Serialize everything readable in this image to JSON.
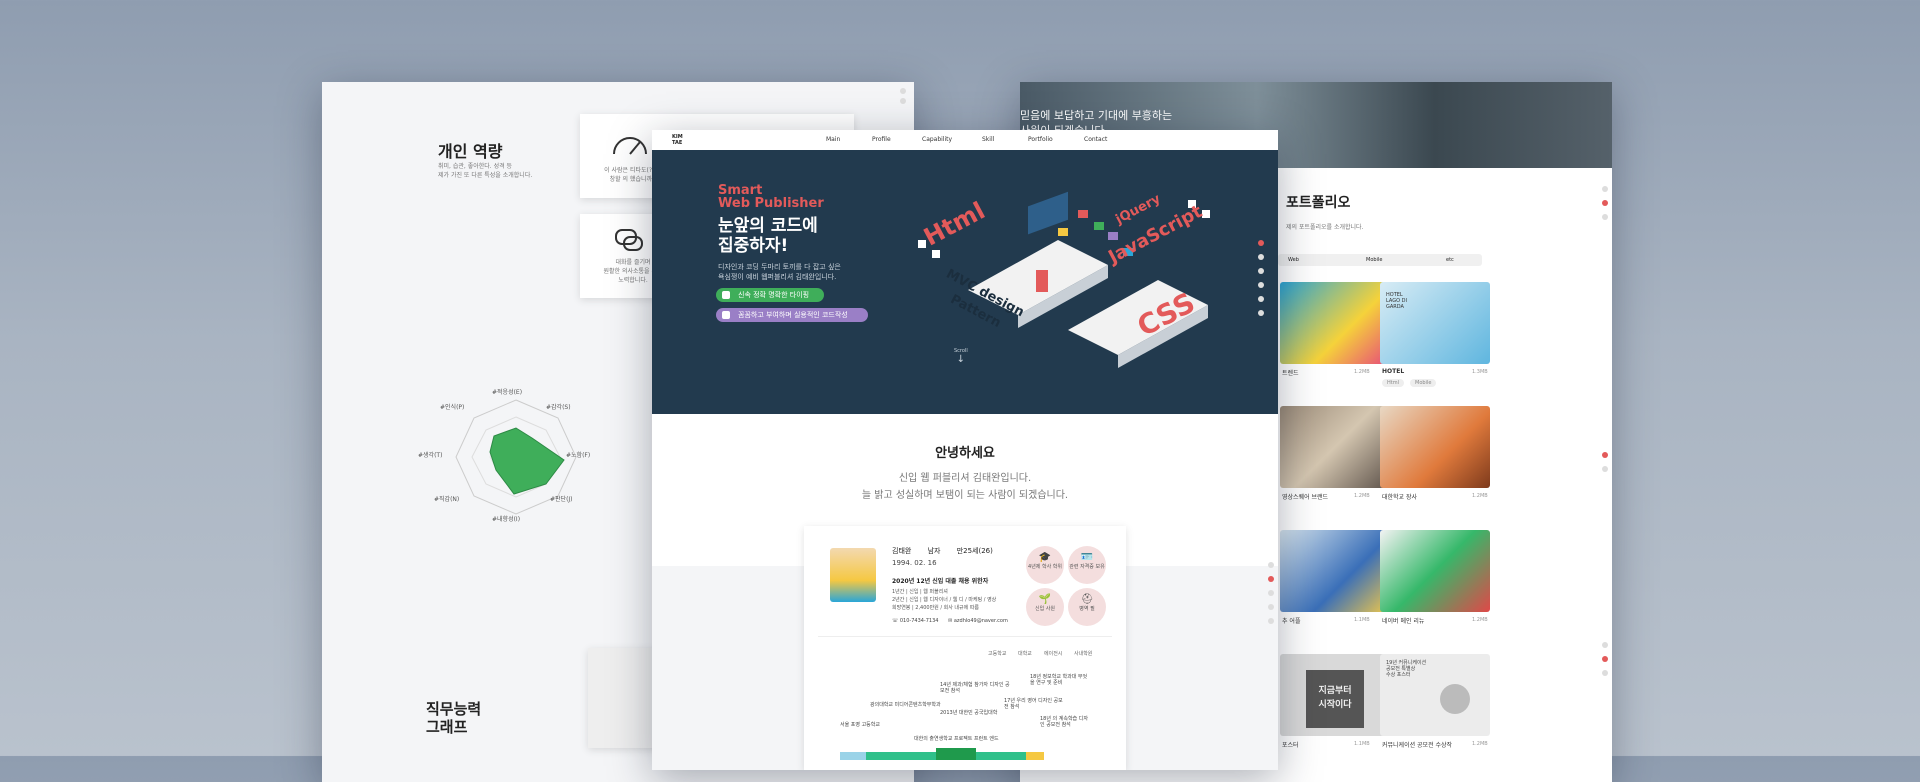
{
  "left": {
    "title1": "개인 역량",
    "desc1_line1": "취미, 습관, 좋아한다. 성격 등",
    "desc1_line2": "제가 가진 또 다른 특성을 소개합니다.",
    "card1_line1": "이 사람은 티타도(?)가",
    "card1_line2": "창할 의 했습니까!",
    "card2_line1": "대화를 즐기며",
    "card2_line2": "원활한 의사소통을 위해",
    "card2_line3": "노력합니다.",
    "radar_labels": [
      "#적응성(E)",
      "#감각(S)",
      "#노함(F)",
      "#판단(J)",
      "#내향성(I)",
      "#직감(N)",
      "#생각(T)",
      "#인식(P)"
    ],
    "title2_line1": "직무능력",
    "title2_line2": "그래프"
  },
  "center": {
    "logo_top": "KIM",
    "logo_bottom": "TAE",
    "nav": [
      "Main",
      "Profile",
      "Capability",
      "Skill",
      "Portfolio",
      "Contact"
    ],
    "hero_tag_line1": "Smart",
    "hero_tag_line2": "Web Publisher",
    "hero_title_line1": "눈앞의 코드에",
    "hero_title_line2": "집중하자!",
    "hero_desc_line1": "디자인과 코딩 두마리 토끼를 다 잡고 싶은",
    "hero_desc_line2": "욕심쟁이 예비 웹퍼블리셔 김태완입니다.",
    "btn1": "신속 정확 명확한 타이핑",
    "btn2": "꼼꼼하고 부여하며 실용적인 코드작성",
    "scroll_label": "Scroll",
    "art_words": [
      "Html",
      "jQuery",
      "JavaScript",
      "MVC design",
      "Pattern",
      "CSS"
    ],
    "greeting_title": "안녕하세요",
    "greeting_line1": "신입 웹 퍼블리셔 김태완입니다.",
    "greeting_line2": "늘 밝고 성실하며 보탬이 되는 사람이 되겠습니다.",
    "profile": {
      "name": "김태완",
      "gender": "남자",
      "age": "만25세(26)",
      "birth": "1994. 02. 16",
      "headline": "2020년 12년 신입 대졸 채용 위한자",
      "line1": "1년간 | 신입 | 웹 퍼블리셔",
      "line2": "2년간 | 신입 | 웹 디자이너 / 웹 디 / 마케팅 / 영상",
      "line3": "희망연봉 | 2,400만원 / 회사 내규에 따름",
      "phone": "010-7434-7134",
      "email": "azdhlo49@naver.com"
    },
    "chips": [
      "4년제 학사 학위",
      "관련 자격증 보유",
      "신입 사원",
      "병역 필"
    ],
    "legend": [
      "고등학교",
      "대학교",
      "에이전시",
      "사내학원"
    ],
    "timeline_labels": [
      "서울 포영 고등학교",
      "광의대학교 미디어콘텐츠학부학과",
      "2013년 대한민 공국입대학",
      "14년 제과/체험 참가자 디자인 공모전 참석",
      "17년 우리 영어 디자인 공모전 참석",
      "18년 정보학교 학과대 무엇을 연구 및 준비",
      "18년 의 계속학습 디자인 공모전 참석",
      "대한의 출연생학교 프로젝트 프런트 엔드"
    ]
  },
  "right": {
    "banner_line1": "믿음에 보답하고 기대에 부흥하는",
    "banner_line2": "사원이 되겠습니다.",
    "title": "포트폴리오",
    "desc": "제의 포트폴리오를 소개합니다.",
    "tabs": [
      "Web",
      "Mobile",
      "etc"
    ],
    "items": [
      {
        "label": "트렌드",
        "size": "1.2MB"
      },
      {
        "label": "HOTEL",
        "size": "1.3MB"
      },
      {
        "label": "영상스퀘어 브랜드",
        "size": "1.2MB"
      },
      {
        "label": "대한학교 장사",
        "size": "1.2MB"
      },
      {
        "label": "추 어플",
        "size": "1.1MB"
      },
      {
        "label": "네이버 메인 리뉴",
        "size": "1.2MB"
      },
      {
        "label": "포스터",
        "size": "1.1MB"
      },
      {
        "label": "커뮤니케이션 공모전 수상작",
        "size": "1.2MB"
      }
    ],
    "hotel_sub_line1": "HOTEL",
    "hotel_sub_line2": "LAGO DI",
    "hotel_sub_line3": "GARDA",
    "poster_text_line1": "지금부터",
    "poster_text_line2": "시작이다",
    "award_thumb_line1": "19년 커뮤니케이션",
    "award_thumb_line2": "공모전 특별상",
    "award_thumb_line3": "수상 포스터",
    "tag_html": "Html",
    "tag_mobile": "Mobile"
  },
  "colors": {
    "hero_bg": "#223a4e",
    "accent_red": "#e35a5a",
    "green": "#3fae5a",
    "purple": "#9a7fc6"
  }
}
